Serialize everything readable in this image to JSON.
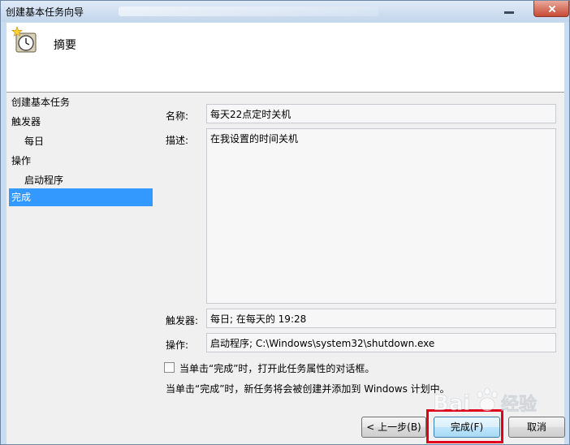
{
  "window": {
    "title": "创建基本任务向导"
  },
  "header": {
    "title": "摘要",
    "icon": "scheduled-task-clock-icon"
  },
  "nav": {
    "items": [
      {
        "label": "创建基本任务",
        "level": 0,
        "selected": false
      },
      {
        "label": "触发器",
        "level": 0,
        "selected": false
      },
      {
        "label": "每日",
        "level": 1,
        "selected": false
      },
      {
        "label": "操作",
        "level": 0,
        "selected": false
      },
      {
        "label": "启动程序",
        "level": 1,
        "selected": false
      },
      {
        "label": "完成",
        "level": 0,
        "selected": true
      }
    ]
  },
  "summary": {
    "name_label": "名称:",
    "name_value": "每天22点定时关机",
    "description_label": "描述:",
    "description_value": "在我设置的时间关机",
    "trigger_label": "触发器:",
    "trigger_value": "每日; 在每天的 19:28",
    "action_label": "操作:",
    "action_value": "启动程序; C:\\Windows\\system32\\shutdown.exe"
  },
  "options": {
    "open_properties_label": "当单击“完成”时，打开此任务属性的对话框。",
    "open_properties_checked": false,
    "note": "当单击“完成”时，新任务将会被创建并添加到 Windows 计划中。"
  },
  "buttons": {
    "back": "< 上一步(B)",
    "finish": "完成(F)",
    "cancel": "取消"
  },
  "colors": {
    "selection": "#3399ff",
    "highlight_frame": "#e0001b"
  },
  "watermark": {
    "brand_left": "Bai",
    "brand_right": "经验"
  }
}
